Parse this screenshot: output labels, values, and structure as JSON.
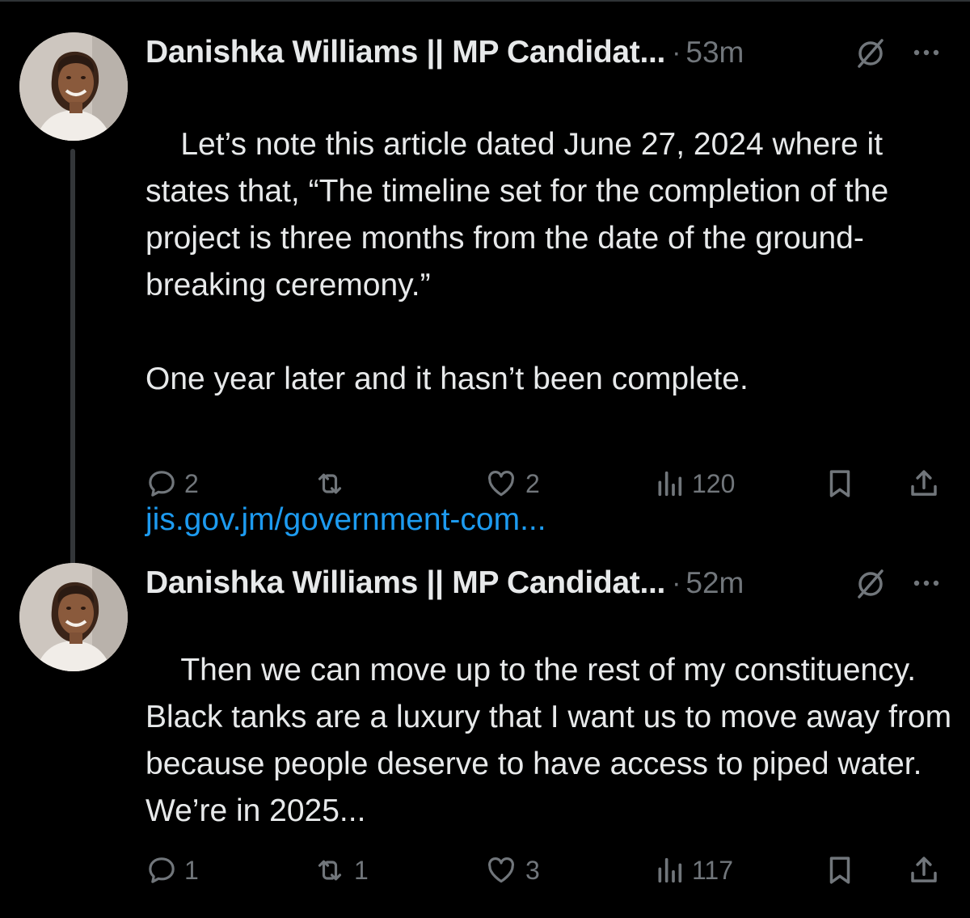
{
  "posts": [
    {
      "author_name": "Danishka Williams || MP Candidat...",
      "separator": "·",
      "time": "53m",
      "text": "Let’s note this article dated June 27, 2024 where it states that, “The timeline set for the completion of the project is three months from the date of the ground-breaking ceremony.”\n\nOne year later and it hasn’t been complete.",
      "link": "jis.gov.jm/government-com...",
      "replies": "2",
      "reposts": "",
      "likes": "2",
      "views": "120"
    },
    {
      "author_name": "Danishka Williams || MP Candidat...",
      "separator": "·",
      "time": "52m",
      "text": "Then we can move up to the rest of my constituency. Black tanks are a luxury that I want us to move away from because people deserve to have access to piped water. We’re in 2025...",
      "link": "",
      "replies": "1",
      "reposts": "1",
      "likes": "3",
      "views": "117"
    }
  ],
  "icons": {
    "reply": "reply-icon",
    "repost": "repost-icon",
    "like": "heart-icon",
    "views": "views-icon",
    "bookmark": "bookmark-icon",
    "share": "share-icon",
    "grok": "grok-icon",
    "more": "more-icon"
  },
  "colors": {
    "background": "#000000",
    "text": "#e7e9ea",
    "muted": "#71767b",
    "link": "#1d9bf0"
  }
}
